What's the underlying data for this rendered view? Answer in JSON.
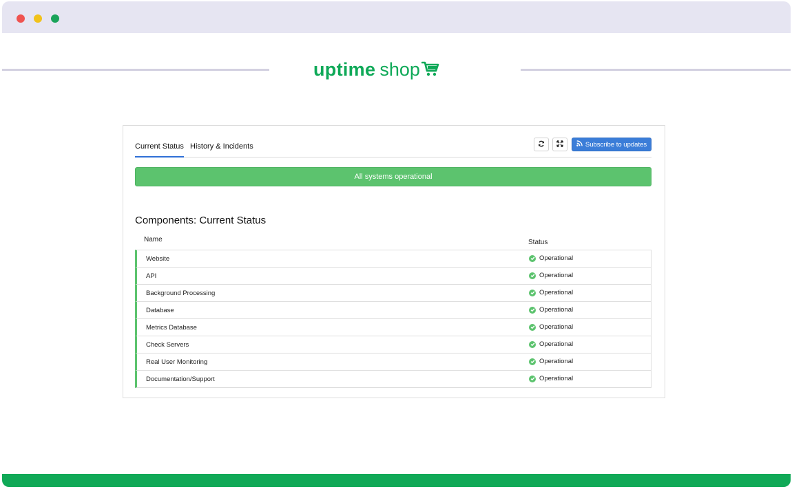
{
  "brand": {
    "word1": "uptime",
    "word2": "shop",
    "color": "#0fa958"
  },
  "colors": {
    "accent": "#3b7dd8",
    "operational": "#5cc36e",
    "footer": "#10a957"
  },
  "tabs": [
    {
      "label": "Current Status",
      "active": true
    },
    {
      "label": "History & Incidents",
      "active": false
    }
  ],
  "toolbar": {
    "refresh_icon": "refresh-icon",
    "expand_icon": "expand-icon",
    "subscribe_label": "Subscribe to updates",
    "subscribe_icon": "rss-icon"
  },
  "banner": {
    "text": "All systems operational"
  },
  "components": {
    "title": "Components: Current Status",
    "columns": {
      "name": "Name",
      "status": "Status"
    },
    "rows": [
      {
        "name": "Website",
        "status": "Operational"
      },
      {
        "name": "API",
        "status": "Operational"
      },
      {
        "name": "Background Processing",
        "status": "Operational"
      },
      {
        "name": "Database",
        "status": "Operational"
      },
      {
        "name": "Metrics Database",
        "status": "Operational"
      },
      {
        "name": "Check Servers",
        "status": "Operational"
      },
      {
        "name": "Real User Monitoring",
        "status": "Operational"
      },
      {
        "name": "Documentation/Support",
        "status": "Operational"
      }
    ]
  }
}
